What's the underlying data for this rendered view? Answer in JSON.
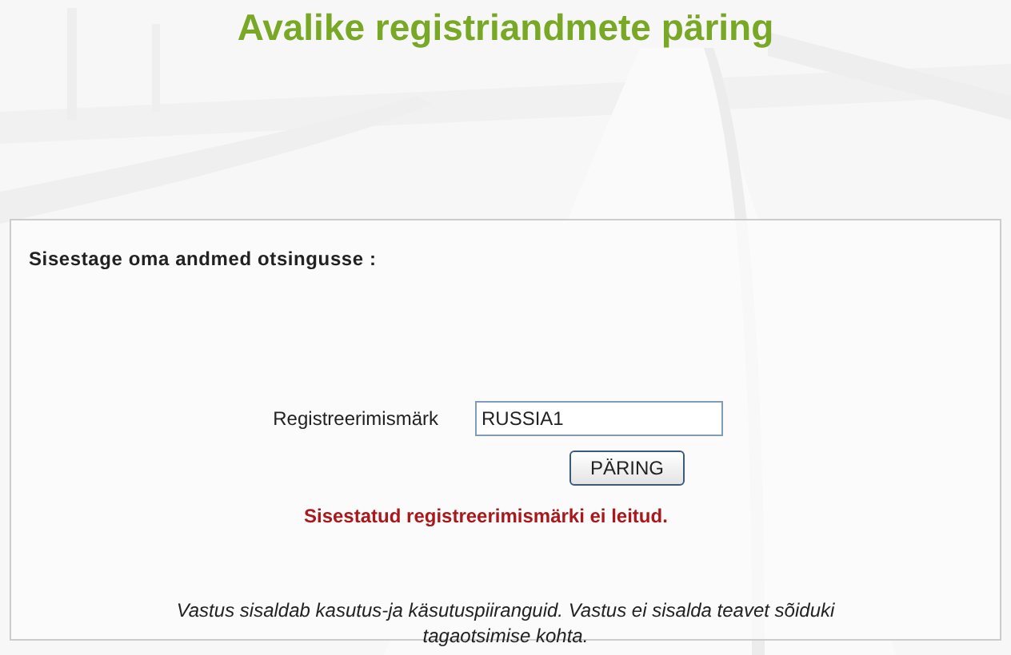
{
  "title": "Avalike registriandmete päring",
  "form": {
    "heading": "Sisestage oma andmed otsingusse :",
    "field": {
      "label": "Registreerimismärk",
      "value": "RUSSIA1"
    },
    "button": "PÄRING",
    "error": "Sisestatud registreerimismärki ei leitud.",
    "notice": "Vastus sisaldab kasutus-ja käsutuspiiranguid. Vastus ei sisalda teavet sõiduki tagaotsimise kohta."
  }
}
